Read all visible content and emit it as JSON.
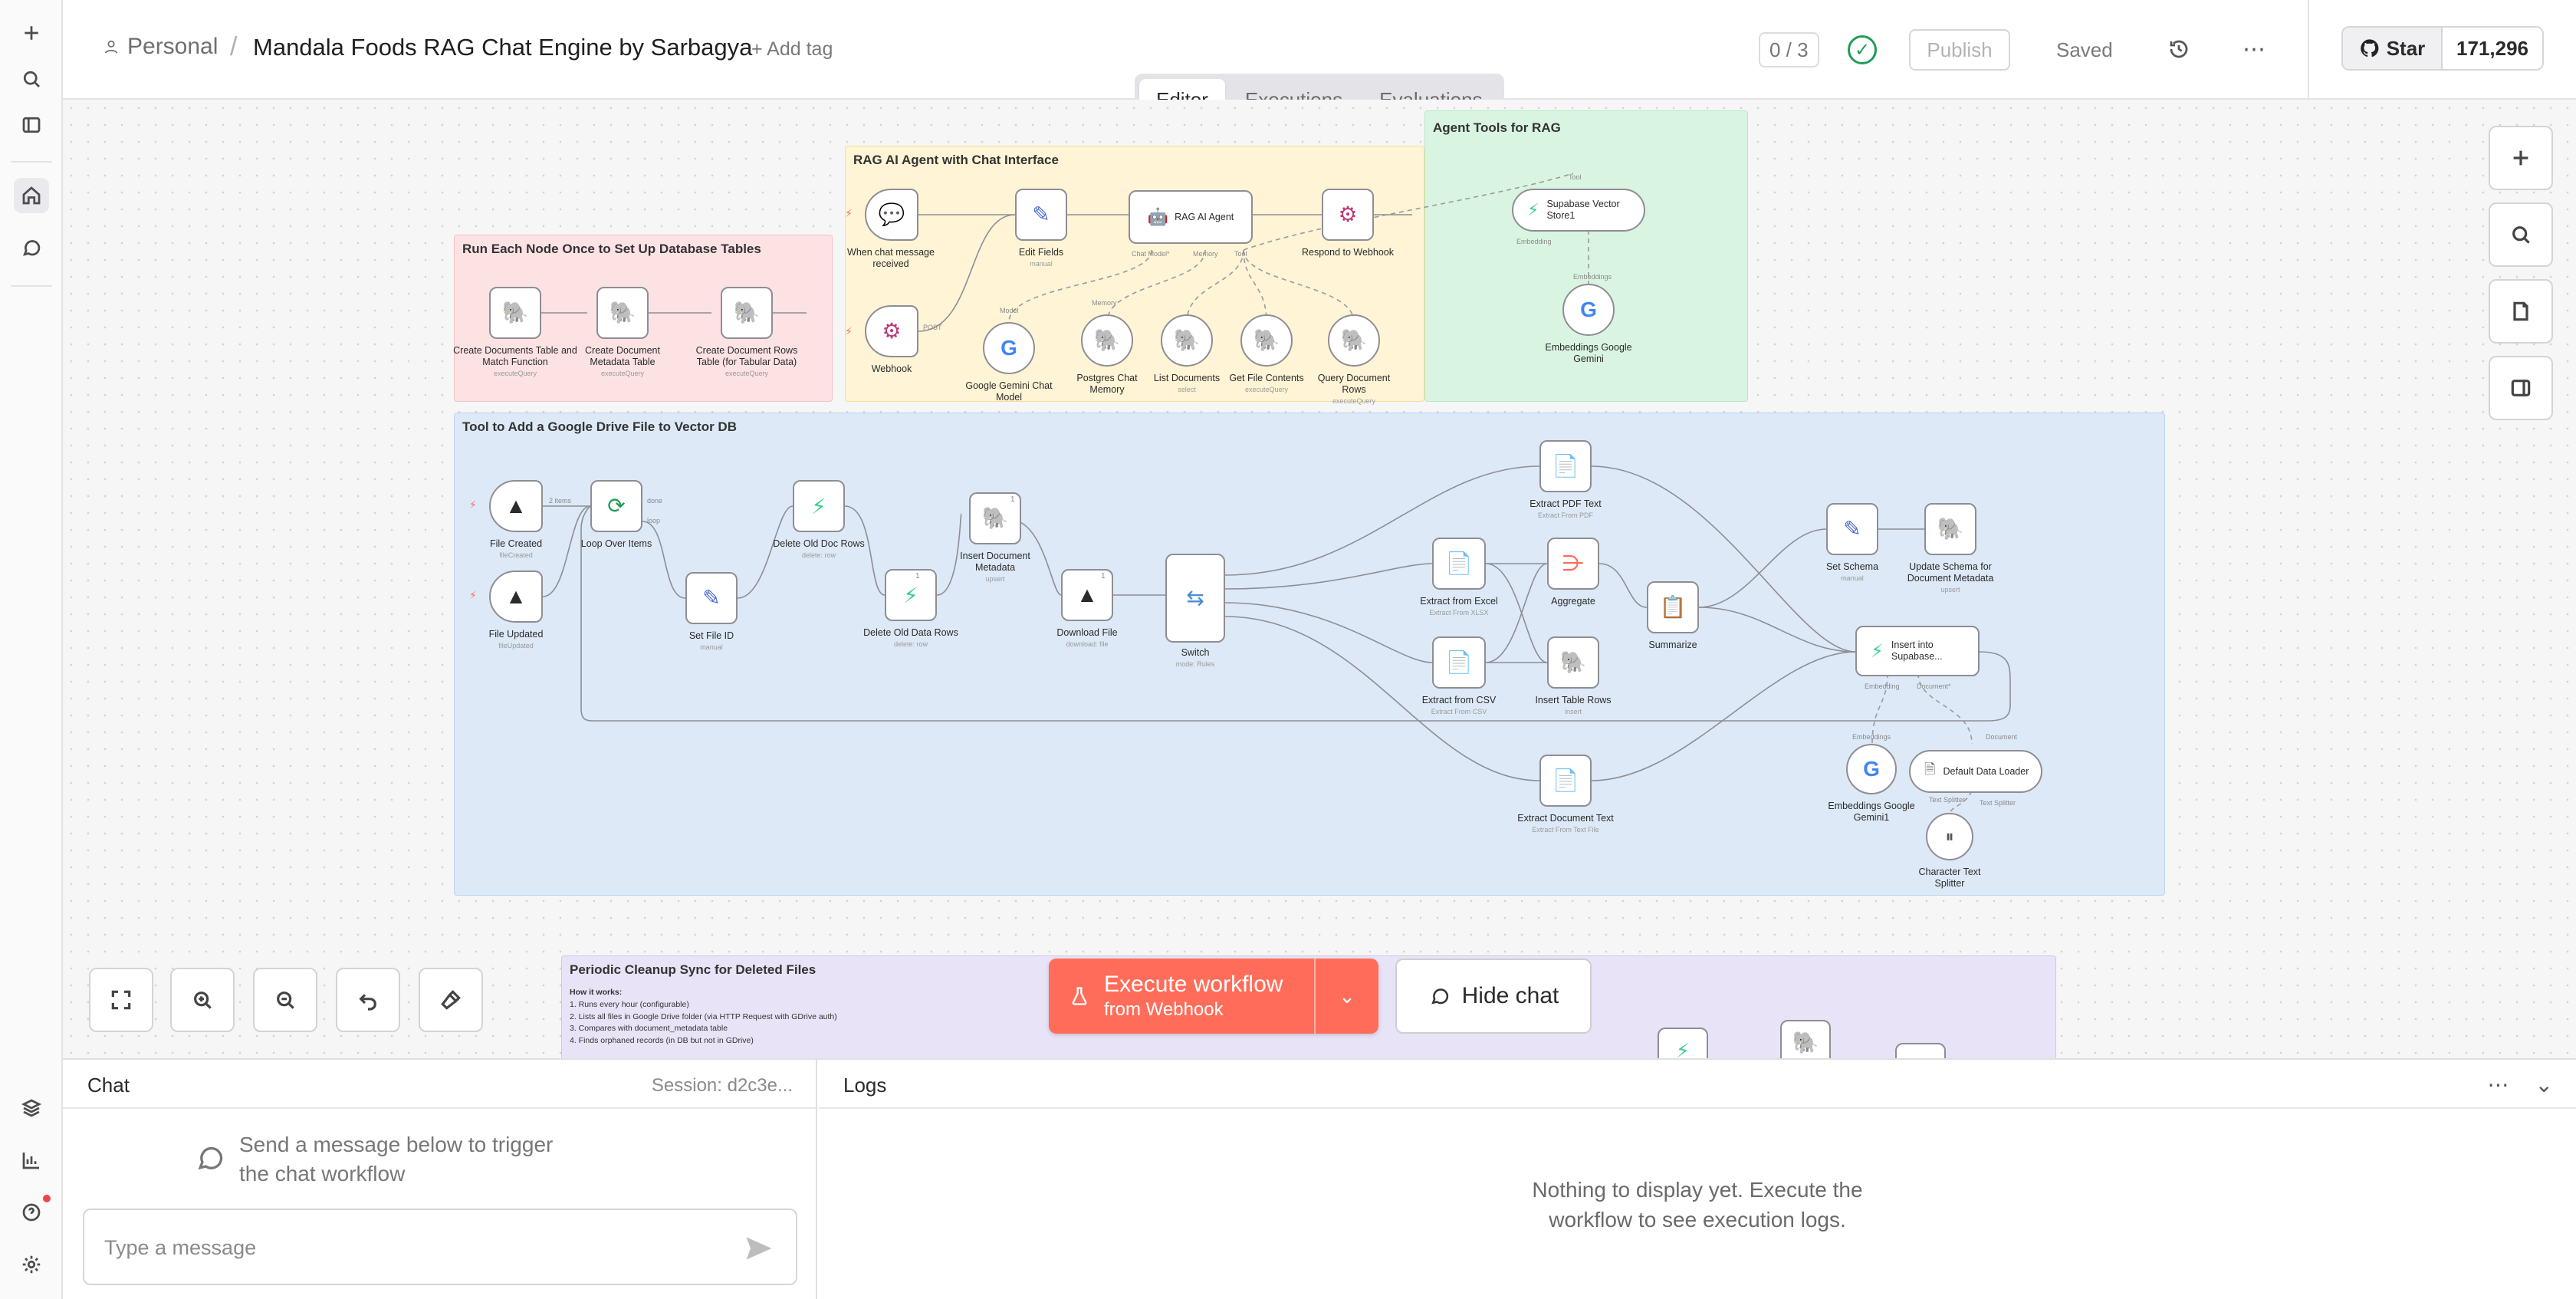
{
  "header": {
    "project": "Personal",
    "title": "Mandala Foods RAG Chat Engine by Sarbagya",
    "add_tag": "+ Add tag",
    "counter": "0 / 3",
    "publish": "Publish",
    "saved": "Saved",
    "github_star": "Star",
    "github_count": "171,296"
  },
  "tabs": [
    {
      "label": "Editor",
      "active": true
    },
    {
      "label": "Executions",
      "active": false
    },
    {
      "label": "Evaluations",
      "active": false
    }
  ],
  "canvas": {
    "stickies": {
      "setup": "Run Each Node Once to Set Up Database Tables",
      "rag": "RAG AI Agent with Chat Interface",
      "agent_tools": "Agent Tools for RAG",
      "drive": "Tool to Add a Google Drive File to Vector DB",
      "cleanup": "Periodic Cleanup Sync for Deleted Files"
    },
    "cleanup_lines": [
      "How it works:",
      "1. Runs every hour (configurable)",
      "2. Lists all files in Google Drive folder (via HTTP Request with GDrive auth)",
      "3. Compares with document_metadata table",
      "4. Finds orphaned records (in DB but not in GDrive)"
    ],
    "nodes": {
      "create_docs": {
        "label": "Create Documents Table and Match Function",
        "sub": "executeQuery"
      },
      "create_meta": {
        "label": "Create Document Metadata Table",
        "sub": "executeQuery"
      },
      "create_rows": {
        "label": "Create Document Rows Table (for Tabular Data)",
        "sub": "executeQuery"
      },
      "chat_trigger": {
        "label": "When chat message received",
        "sub": ""
      },
      "edit_fields": {
        "label": "Edit Fields",
        "sub": "manual"
      },
      "rag_agent": {
        "label": "RAG AI Agent",
        "sub": ""
      },
      "respond": {
        "label": "Respond to Webhook",
        "sub": ""
      },
      "webhook": {
        "label": "Webhook",
        "sub": ""
      },
      "gemini_chat": {
        "label": "Google Gemini Chat Model",
        "sub": ""
      },
      "pg_memory": {
        "label": "Postgres Chat Memory",
        "sub": ""
      },
      "list_docs": {
        "label": "List Documents",
        "sub": "select"
      },
      "file_contents": {
        "label": "Get File Contents",
        "sub": "executeQuery"
      },
      "query_rows": {
        "label": "Query Document Rows",
        "sub": "executeQuery"
      },
      "supabase_store": {
        "label": "Supabase Vector Store1",
        "sub": ""
      },
      "embed_gemini": {
        "label": "Embeddings Google Gemini",
        "sub": ""
      },
      "file_created": {
        "label": "File Created",
        "sub": "fileCreated"
      },
      "file_updated": {
        "label": "File Updated",
        "sub": "fileUpdated"
      },
      "loop": {
        "label": "Loop Over Items",
        "sub": ""
      },
      "set_file_id": {
        "label": "Set File ID",
        "sub": "manual"
      },
      "del_doc_rows": {
        "label": "Delete Old Doc Rows",
        "sub": "delete: row"
      },
      "del_data_rows": {
        "label": "Delete Old Data Rows",
        "sub": "delete: row"
      },
      "insert_meta": {
        "label": "Insert Document Metadata",
        "sub": "upsert"
      },
      "download": {
        "label": "Download File",
        "sub": "download: file"
      },
      "switch": {
        "label": "Switch",
        "sub": "mode: Rules"
      },
      "extract_pdf": {
        "label": "Extract PDF Text",
        "sub": "Extract From PDF"
      },
      "extract_excel": {
        "label": "Extract from Excel",
        "sub": "Extract From XLSX"
      },
      "aggregate": {
        "label": "Aggregate",
        "sub": ""
      },
      "extract_csv": {
        "label": "Extract from CSV",
        "sub": "Extract From CSV"
      },
      "insert_rows": {
        "label": "Insert Table Rows",
        "sub": "insert"
      },
      "summarize": {
        "label": "Summarize",
        "sub": ""
      },
      "set_schema": {
        "label": "Set Schema",
        "sub": "manual"
      },
      "update_schema": {
        "label": "Update Schema for Document Metadata",
        "sub": "upsert"
      },
      "insert_supabase": {
        "label": "Insert into Supabase...",
        "sub": ""
      },
      "extract_doc": {
        "label": "Extract Document Text",
        "sub": "Extract From Text File"
      },
      "embed_gemini1": {
        "label": "Embeddings Google Gemini1",
        "sub": ""
      },
      "data_loader": {
        "label": "Default Data Loader",
        "sub": ""
      },
      "text_splitter": {
        "label": "Character Text Splitter",
        "sub": ""
      }
    },
    "ports": {
      "chat_model": "Chat Model*",
      "memory": "Memory",
      "tool": "Tool",
      "embedding": "Embedding",
      "embeddings": "Embeddings",
      "model": "Model",
      "post": "POST",
      "items": "2 items",
      "done": "done",
      "loop": "loop",
      "document": "Document",
      "text_splitter": "Text Splitter",
      "doc_plus": "Document*"
    },
    "badges": {
      "one": "1"
    }
  },
  "execute": {
    "line1": "Execute workflow",
    "line2": "from Webhook"
  },
  "hide_chat": "Hide chat",
  "chat": {
    "title": "Chat",
    "session": "Session: d2c3e...",
    "hint_line1": "Send a message below to trigger",
    "hint_line2": "the chat workflow",
    "placeholder": "Type a message"
  },
  "logs": {
    "title": "Logs",
    "empty_line1": "Nothing to display yet. Execute the",
    "empty_line2": "workflow to see execution logs."
  }
}
